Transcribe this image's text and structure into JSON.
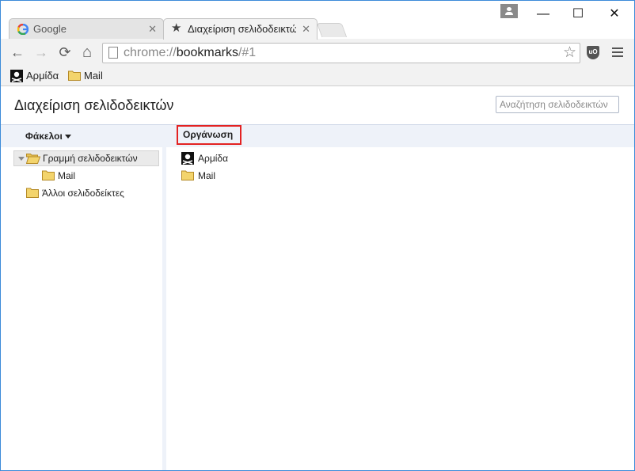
{
  "tabs": [
    {
      "title": "Google",
      "close": "✕",
      "icon": "google-favicon"
    },
    {
      "title": "Διαχείριση σελιδοδεικτών",
      "close": "✕",
      "icon": "star-icon"
    }
  ],
  "window_controls": {
    "minimize": "—",
    "maximize": "☐",
    "close": "✕"
  },
  "toolbar": {
    "back": "←",
    "forward": "→",
    "reload": "⟳",
    "home": "⌂",
    "url_scheme": "chrome://",
    "url_host": "bookmarks",
    "url_path": "/#1",
    "star": "☆",
    "ublock_label": "uO"
  },
  "bookmarks_bar": [
    {
      "label": "Αρμίδα",
      "icon": "pirate-flag-icon"
    },
    {
      "label": "Mail",
      "icon": "folder-icon"
    }
  ],
  "page": {
    "title": "Διαχείριση σελιδοδεικτών",
    "search_placeholder": "Αναζήτηση σελιδοδεικτών"
  },
  "menus": {
    "folders_label": "Φάκελοι",
    "organize_label": "Οργάνωση"
  },
  "tree": [
    {
      "label": "Γραμμή σελιδοδεικτών",
      "selected": true,
      "expanded": true
    },
    {
      "label": "Mail"
    },
    {
      "label": "Άλλοι σελιδοδείκτες"
    }
  ],
  "list": [
    {
      "label": "Αρμίδα",
      "icon": "pirate-flag-icon"
    },
    {
      "label": "Mail",
      "icon": "folder-icon"
    }
  ],
  "colors": {
    "accent_border": "#3c8bd9",
    "highlight_red": "#e32222",
    "menubar_bg": "#eef2f9",
    "folder_yellow": "#f3d46c"
  }
}
